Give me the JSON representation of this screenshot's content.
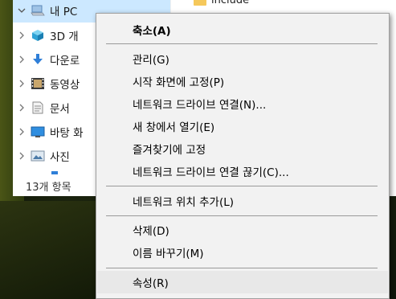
{
  "navigation": {
    "items": [
      {
        "label": "내 PC",
        "icon": "computer-icon",
        "expanded": true,
        "selected": true
      },
      {
        "label": "3D 개",
        "icon": "3d-objects-icon"
      },
      {
        "label": "다운로",
        "icon": "downloads-icon"
      },
      {
        "label": "동영상",
        "icon": "videos-icon"
      },
      {
        "label": "문서",
        "icon": "documents-icon"
      },
      {
        "label": "바탕 화",
        "icon": "desktop-icon"
      },
      {
        "label": "사진",
        "icon": "pictures-icon"
      }
    ]
  },
  "status_bar": {
    "item_count": "13개 항목"
  },
  "content": {
    "visible_file": "include"
  },
  "context_menu": {
    "items": [
      {
        "label": "축소(A)",
        "bold": true
      },
      {
        "label": "관리(G)"
      },
      {
        "label": "시작 화면에 고정(P)"
      },
      {
        "label": "네트워크 드라이브 연결(N)..."
      },
      {
        "label": "새 창에서 열기(E)"
      },
      {
        "label": "즐겨찾기에 고정"
      },
      {
        "label": "네트워크 드라이브 연결 끊기(C)..."
      },
      {
        "label": "네트워크 위치 추가(L)"
      },
      {
        "label": "삭제(D)"
      },
      {
        "label": "이름 바꾸기(M)"
      },
      {
        "label": "속성(R)",
        "hovered": true
      }
    ]
  },
  "colors": {
    "selection": "#cce8ff",
    "menu_background": "#f2f2f2",
    "menu_hover": "#e8e8e8"
  }
}
